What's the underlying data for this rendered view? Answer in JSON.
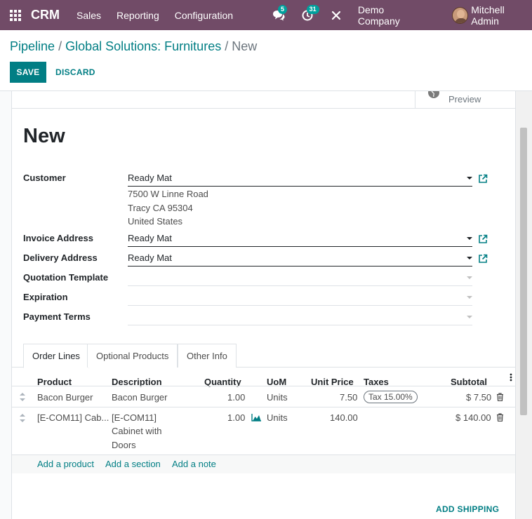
{
  "navbar": {
    "brand": "CRM",
    "menu": [
      "Sales",
      "Reporting",
      "Configuration"
    ],
    "messages_count": "5",
    "activities_count": "31",
    "company": "Demo Company",
    "user": "Mitchell Admin",
    "bg_color": "#714b67"
  },
  "breadcrumb": {
    "items": [
      "Pipeline",
      "Global Solutions: Furnitures"
    ],
    "separator": "/",
    "current": "New"
  },
  "actions": {
    "save": "SAVE",
    "discard": "DISCARD"
  },
  "statusbar": {
    "preview": "Preview"
  },
  "form": {
    "title": "New",
    "customer": {
      "label": "Customer",
      "value": "Ready Mat",
      "address": [
        "7500 W Linne Road",
        "Tracy CA 95304",
        "United States"
      ]
    },
    "invoice_address": {
      "label": "Invoice Address",
      "value": "Ready Mat"
    },
    "delivery_address": {
      "label": "Delivery Address",
      "value": "Ready Mat"
    },
    "quotation_template": {
      "label": "Quotation Template",
      "value": ""
    },
    "expiration": {
      "label": "Expiration",
      "value": ""
    },
    "payment_terms": {
      "label": "Payment Terms",
      "value": ""
    }
  },
  "tabs": [
    "Order Lines",
    "Optional Products",
    "Other Info"
  ],
  "order_lines": {
    "columns": [
      "Product",
      "Description",
      "Quantity",
      "UoM",
      "Unit Price",
      "Taxes",
      "Subtotal"
    ],
    "rows": [
      {
        "product": "Bacon Burger",
        "description": [
          "Bacon Burger"
        ],
        "quantity": "1.00",
        "uom": "Units",
        "unit_price": "7.50",
        "taxes": "Tax 15.00%",
        "subtotal": "$ 7.50"
      },
      {
        "product": "[E-COM11] Cab...",
        "description": [
          "[E-COM11]",
          "Cabinet with",
          "Doors"
        ],
        "quantity": "1.00",
        "uom": "Units",
        "unit_price": "140.00",
        "taxes": "",
        "subtotal": "$ 140.00"
      }
    ],
    "add_product": "Add a product",
    "add_section": "Add a section",
    "add_note": "Add a note"
  },
  "add_shipping": "ADD SHIPPING",
  "accent_color": "#017e84"
}
